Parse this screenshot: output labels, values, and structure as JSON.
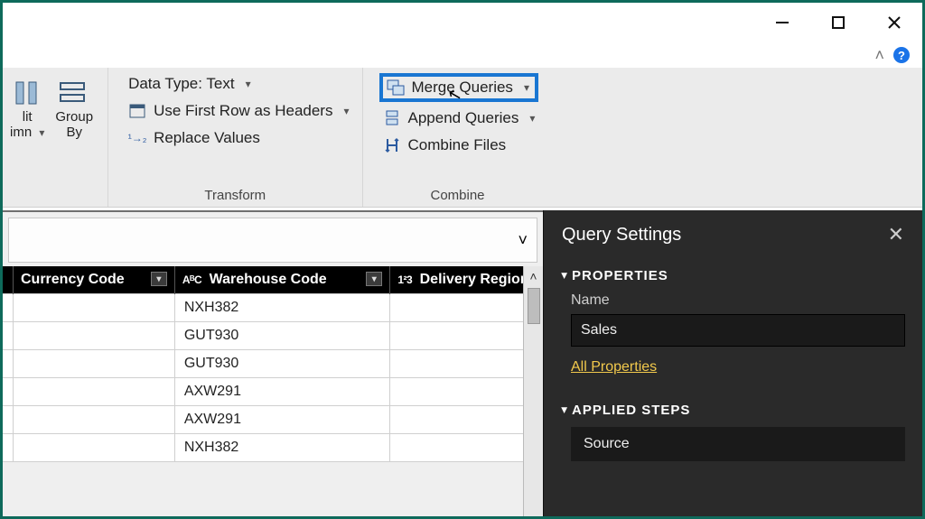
{
  "window": {
    "minimize": "minimize",
    "maximize": "maximize",
    "close": "close"
  },
  "qat": {
    "collapse": "^",
    "help": "?"
  },
  "ribbon": {
    "split": {
      "line1": "lit",
      "line2": "imn"
    },
    "group_by": {
      "line1": "Group",
      "line2": "By"
    },
    "transform": {
      "data_type": "Data Type: Text",
      "first_row": "Use First Row as Headers",
      "replace_values": "Replace Values",
      "replace_prefix": "1→2",
      "group_label": "Transform"
    },
    "combine": {
      "merge": "Merge Queries",
      "append": "Append Queries",
      "combine_files": "Combine Files",
      "group_label": "Combine"
    }
  },
  "grid": {
    "columns": {
      "currency": "Currency Code",
      "warehouse": "Warehouse Code",
      "delivery": "Delivery Regior",
      "lead_partial": ""
    },
    "type_text": "AᴮC",
    "type_num": "1²3",
    "rows": [
      {
        "lead": "",
        "currency": "",
        "warehouse": "NXH382",
        "delivery": ""
      },
      {
        "lead": "",
        "currency": "",
        "warehouse": "GUT930",
        "delivery": ""
      },
      {
        "lead": "",
        "currency": "",
        "warehouse": "GUT930",
        "delivery": ""
      },
      {
        "lead": "",
        "currency": "",
        "warehouse": "AXW291",
        "delivery": ""
      },
      {
        "lead": "",
        "currency": "",
        "warehouse": "AXW291",
        "delivery": ""
      },
      {
        "lead": "",
        "currency": "",
        "warehouse": "NXH382",
        "delivery": ""
      }
    ]
  },
  "settings": {
    "title": "Query Settings",
    "properties_h": "PROPERTIES",
    "name_label": "Name",
    "name_value": "Sales",
    "all_properties": "All Properties",
    "applied_h": "APPLIED STEPS",
    "step1": "Source"
  }
}
